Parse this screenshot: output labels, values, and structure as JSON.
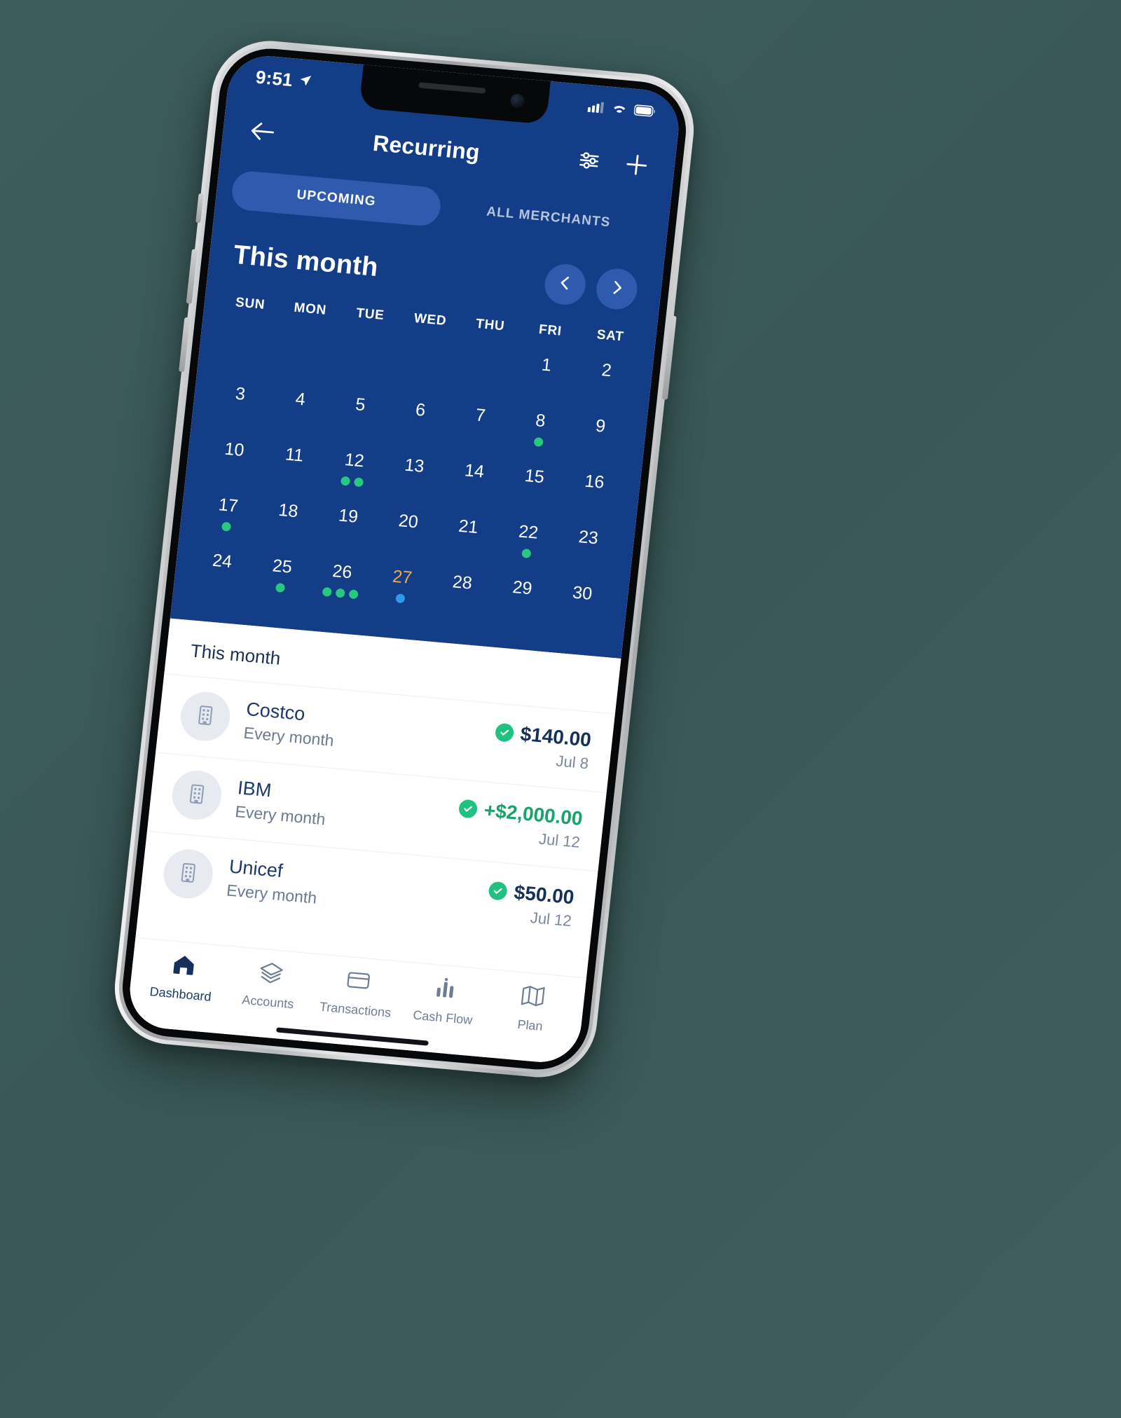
{
  "status_bar": {
    "time": "9:51",
    "location_icon": "location-arrow-icon",
    "cellular_icon": "cellular-signal-icon",
    "wifi_icon": "wifi-icon",
    "battery_icon": "battery-icon"
  },
  "nav": {
    "back_icon": "arrow-left-icon",
    "title": "Recurring",
    "filter_icon": "filter-sliders-icon",
    "add_icon": "plus-icon"
  },
  "tabs": [
    {
      "label": "UPCOMING",
      "active": true
    },
    {
      "label": "ALL MERCHANTS",
      "active": false
    }
  ],
  "calendar": {
    "title": "This month",
    "prev_icon": "chevron-left-icon",
    "next_icon": "chevron-right-icon",
    "weekdays": [
      "SUN",
      "MON",
      "TUE",
      "WED",
      "THU",
      "FRI",
      "SAT"
    ],
    "leading_blanks": 5,
    "days": [
      {
        "num": "1",
        "dots": []
      },
      {
        "num": "2",
        "dots": []
      },
      {
        "num": "3",
        "dots": []
      },
      {
        "num": "4",
        "dots": []
      },
      {
        "num": "5",
        "dots": []
      },
      {
        "num": "6",
        "dots": []
      },
      {
        "num": "7",
        "dots": []
      },
      {
        "num": "8",
        "dots": [
          "green"
        ]
      },
      {
        "num": "9",
        "dots": []
      },
      {
        "num": "10",
        "dots": []
      },
      {
        "num": "11",
        "dots": []
      },
      {
        "num": "12",
        "dots": [
          "green",
          "green"
        ]
      },
      {
        "num": "13",
        "dots": []
      },
      {
        "num": "14",
        "dots": []
      },
      {
        "num": "15",
        "dots": []
      },
      {
        "num": "16",
        "dots": []
      },
      {
        "num": "17",
        "dots": [
          "green"
        ]
      },
      {
        "num": "18",
        "dots": []
      },
      {
        "num": "19",
        "dots": []
      },
      {
        "num": "20",
        "dots": []
      },
      {
        "num": "21",
        "dots": []
      },
      {
        "num": "22",
        "dots": [
          "green"
        ]
      },
      {
        "num": "23",
        "dots": []
      },
      {
        "num": "24",
        "dots": []
      },
      {
        "num": "25",
        "dots": [
          "green"
        ]
      },
      {
        "num": "26",
        "dots": [
          "green",
          "green",
          "green"
        ]
      },
      {
        "num": "27",
        "dots": [
          "blue"
        ],
        "today": true
      },
      {
        "num": "28",
        "dots": []
      },
      {
        "num": "29",
        "dots": []
      },
      {
        "num": "30",
        "dots": []
      }
    ]
  },
  "list": {
    "header": "This month",
    "rows": [
      {
        "avatar_icon": "building-icon",
        "merchant": "Costco",
        "frequency": "Every month",
        "amount": "$140.00",
        "positive": false,
        "date": "Jul 8",
        "status_icon": "check-circle-icon"
      },
      {
        "avatar_icon": "building-icon",
        "merchant": "IBM",
        "frequency": "Every month",
        "amount": "+$2,000.00",
        "positive": true,
        "date": "Jul 12",
        "status_icon": "check-circle-icon"
      },
      {
        "avatar_icon": "building-icon",
        "merchant": "Unicef",
        "frequency": "Every month",
        "amount": "$50.00",
        "positive": false,
        "date": "Jul 12",
        "status_icon": "check-circle-icon"
      }
    ]
  },
  "bottom_nav": [
    {
      "label": "Dashboard",
      "icon": "home-icon",
      "active": true
    },
    {
      "label": "Accounts",
      "icon": "layers-icon",
      "active": false
    },
    {
      "label": "Transactions",
      "icon": "credit-card-icon",
      "active": false
    },
    {
      "label": "Cash Flow",
      "icon": "bar-chart-icon",
      "active": false
    },
    {
      "label": "Plan",
      "icon": "map-icon",
      "active": false
    }
  ],
  "colors": {
    "brand_blue": "#143d88",
    "tab_active": "#2f5aae",
    "accent_green": "#26c97f",
    "accent_blue_dot": "#2b9bea",
    "today_gold": "#eaa947",
    "positive_green": "#16a46a"
  }
}
